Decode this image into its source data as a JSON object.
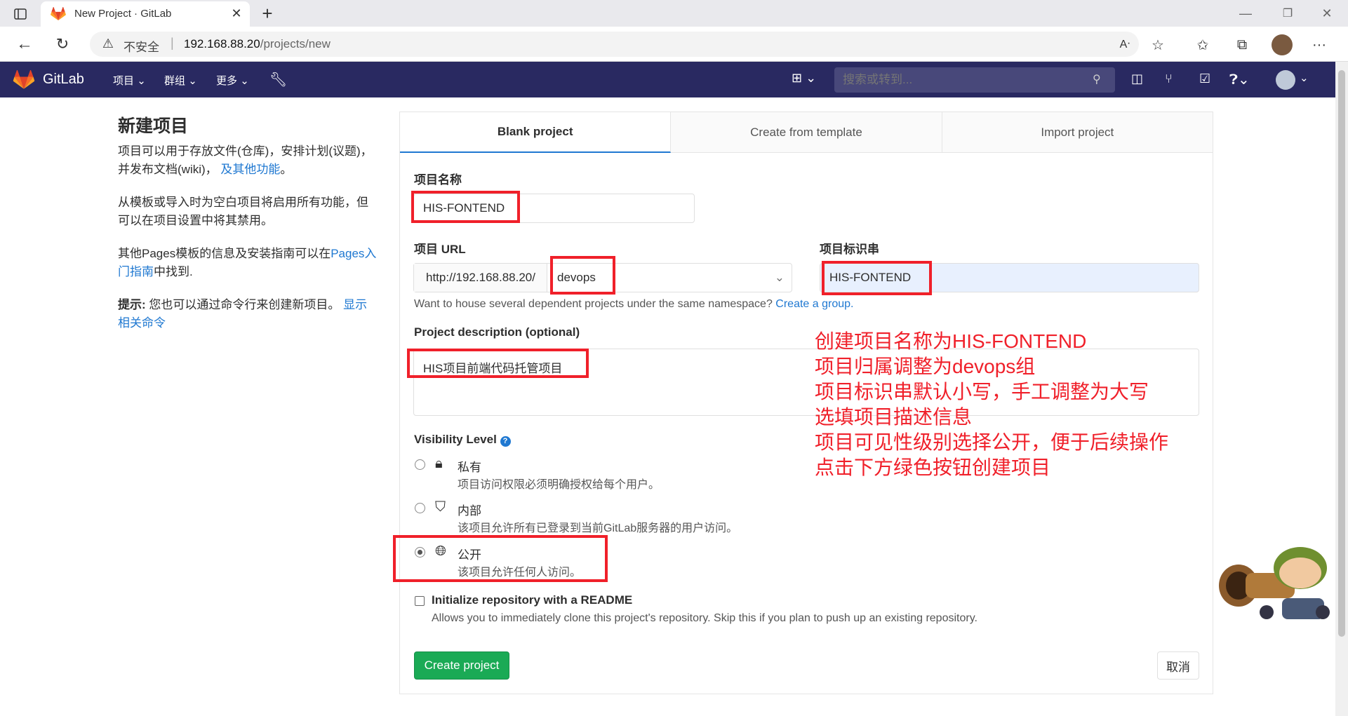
{
  "browser": {
    "tab_title": "New Project · GitLab",
    "security_label": "不安全",
    "url_host": "192.168.88.20",
    "url_path": "/projects/new"
  },
  "nav": {
    "brand": "GitLab",
    "items": [
      "项目",
      "群组",
      "更多"
    ],
    "search_placeholder": "搜索或转到..."
  },
  "sidebar": {
    "title": "新建项目",
    "p1_text": "项目可以用于存放文件(仓库)，安排计划(议题)，并发布文档(wiki)，",
    "p1_link": "及其他功能",
    "p1_end": "。",
    "p2": "从模板或导入时为空白项目将启用所有功能，但可以在项目设置中将其禁用。",
    "p3_start": "其他Pages模板的信息及安装指南可以在",
    "p3_link": "Pages入门指南",
    "p3_end": "中找到.",
    "tip_label": "提示:",
    "tip_text": "您也可以通过命令行来创建新项目。",
    "tip_link": "显示相关命令"
  },
  "tabs": [
    "Blank project",
    "Create from template",
    "Import project"
  ],
  "form": {
    "name_label": "项目名称",
    "name_value": "HIS-FONTEND",
    "url_label": "项目 URL",
    "url_prefix": "http://192.168.88.20/",
    "url_namespace": "devops",
    "slug_label": "项目标识串",
    "slug_value": "HIS-FONTEND",
    "group_hint": "Want to house several dependent projects under the same namespace?",
    "group_link": "Create a group.",
    "desc_label": "Project description (optional)",
    "desc_value": "HIS项目前端代码托管项目",
    "visibility_label": "Visibility Level",
    "visibility": [
      {
        "title": "私有",
        "desc": "项目访问权限必须明确授权给每个用户。",
        "selected": false
      },
      {
        "title": "内部",
        "desc": "该项目允许所有已登录到当前GitLab服务器的用户访问。",
        "selected": false
      },
      {
        "title": "公开",
        "desc": "该项目允许任何人访问。",
        "selected": true
      }
    ],
    "readme_label": "Initialize repository with a README",
    "readme_desc": "Allows you to immediately clone this project's repository. Skip this if you plan to push up an existing repository.",
    "create_button": "Create project",
    "cancel_button": "取消"
  },
  "annotation": [
    "创建项目名称为HIS-FONTEND",
    "项目归属调整为devops组",
    "项目标识串默认小写，手工调整为大写",
    "选填项目描述信息",
    "项目可见性级别选择公开，便于后续操作",
    "点击下方绿色按钮创建项目"
  ],
  "colors": {
    "nav_bg": "#292961",
    "link": "#1f78d1",
    "create_button": "#1aaa55",
    "annotation_red": "#f0202a"
  }
}
